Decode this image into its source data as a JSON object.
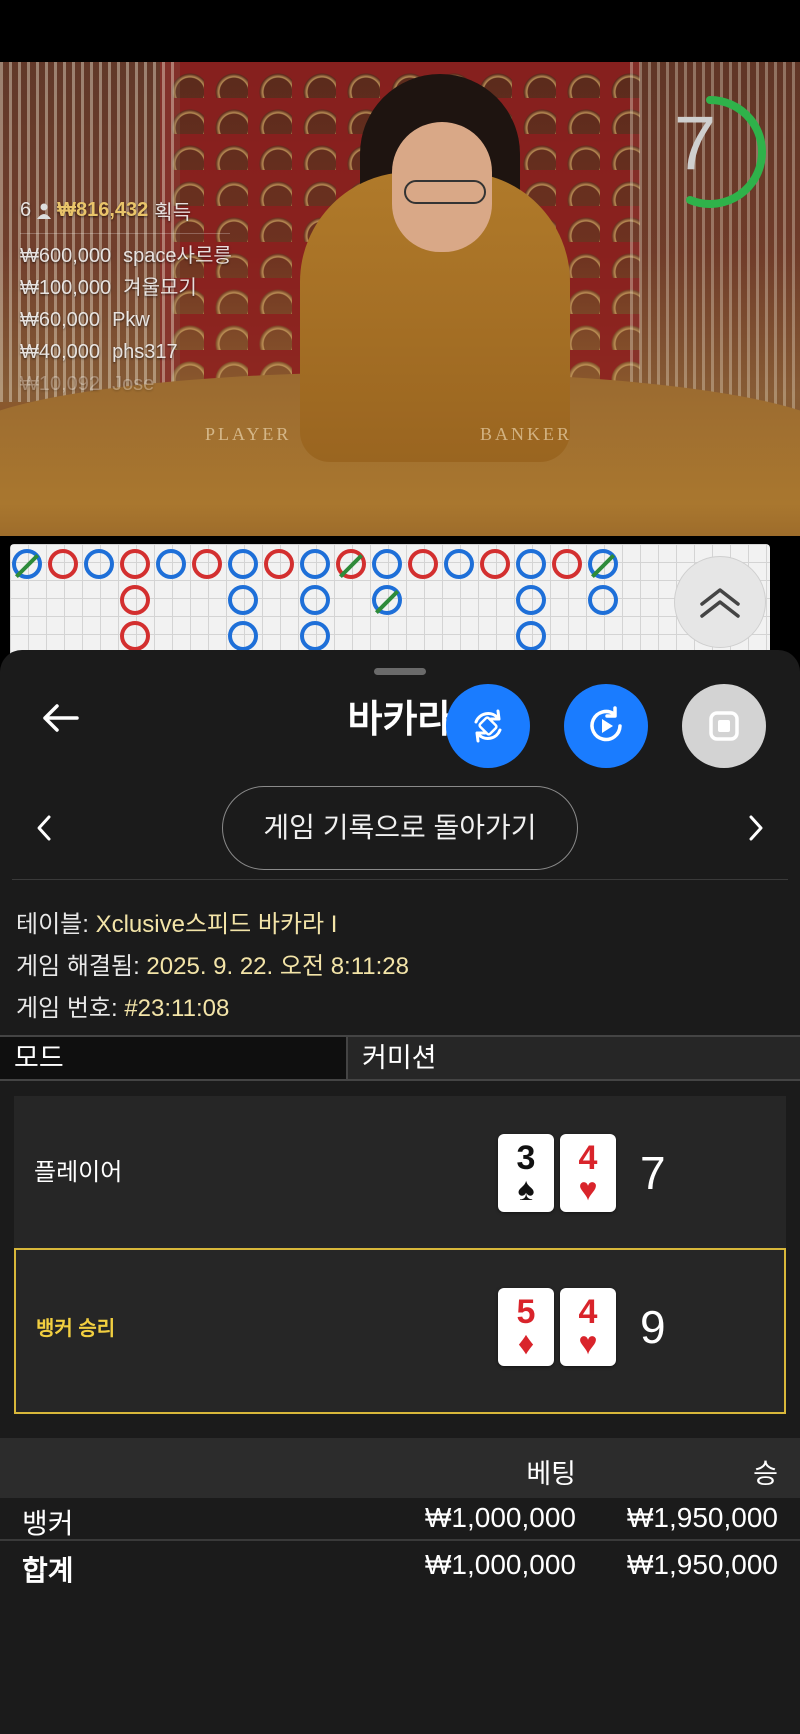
{
  "video": {
    "timer_value": "7",
    "table_labels": {
      "player": "PLAYER",
      "banker": "BANKER"
    },
    "winners": {
      "count": "6",
      "amount": "₩816,432",
      "suffix": "획득",
      "entries": [
        {
          "amount": "₩600,000",
          "name": "space사르릉"
        },
        {
          "amount": "₩100,000",
          "name": "겨울모기"
        },
        {
          "amount": "₩60,000",
          "name": "Pkw"
        },
        {
          "amount": "₩40,000",
          "name": "phs317"
        },
        {
          "amount": "₩10,092",
          "name": "Jose"
        }
      ]
    }
  },
  "roadmap": {
    "colors": {
      "banker": "#d32f2f",
      "player": "#1e6fd8",
      "tie": "#2e8b3a"
    }
  },
  "sheet": {
    "title": "바카라",
    "history_button": "게임 기록으로 돌아가기",
    "table_label": "테이블:",
    "table_value": "Xclusive스피드 바카라 I",
    "resolved_label": "게임 해결됨:",
    "resolved_value": "2025. 9. 22. 오전 8:11:28",
    "game_no_label": "게임 번호:",
    "game_no_value": "#23:11:08",
    "mode_label": "모드",
    "mode_value": "커미션",
    "player": {
      "label": "플레이어",
      "cards": [
        {
          "rank": "3",
          "suit": "♠",
          "color": "black"
        },
        {
          "rank": "4",
          "suit": "♥",
          "color": "red"
        }
      ],
      "score": "7"
    },
    "banker": {
      "label": "뱅커 승리",
      "cards": [
        {
          "rank": "5",
          "suit": "♦",
          "color": "red"
        },
        {
          "rank": "4",
          "suit": "♥",
          "color": "red"
        }
      ],
      "score": "9"
    },
    "bets": {
      "col_bet": "베팅",
      "col_win": "승",
      "rows": [
        {
          "label": "뱅커",
          "bet": "₩1,000,000",
          "win": "₩1,950,000"
        },
        {
          "label": "합계",
          "bet": "₩1,000,000",
          "win": "₩1,950,000"
        }
      ]
    }
  }
}
